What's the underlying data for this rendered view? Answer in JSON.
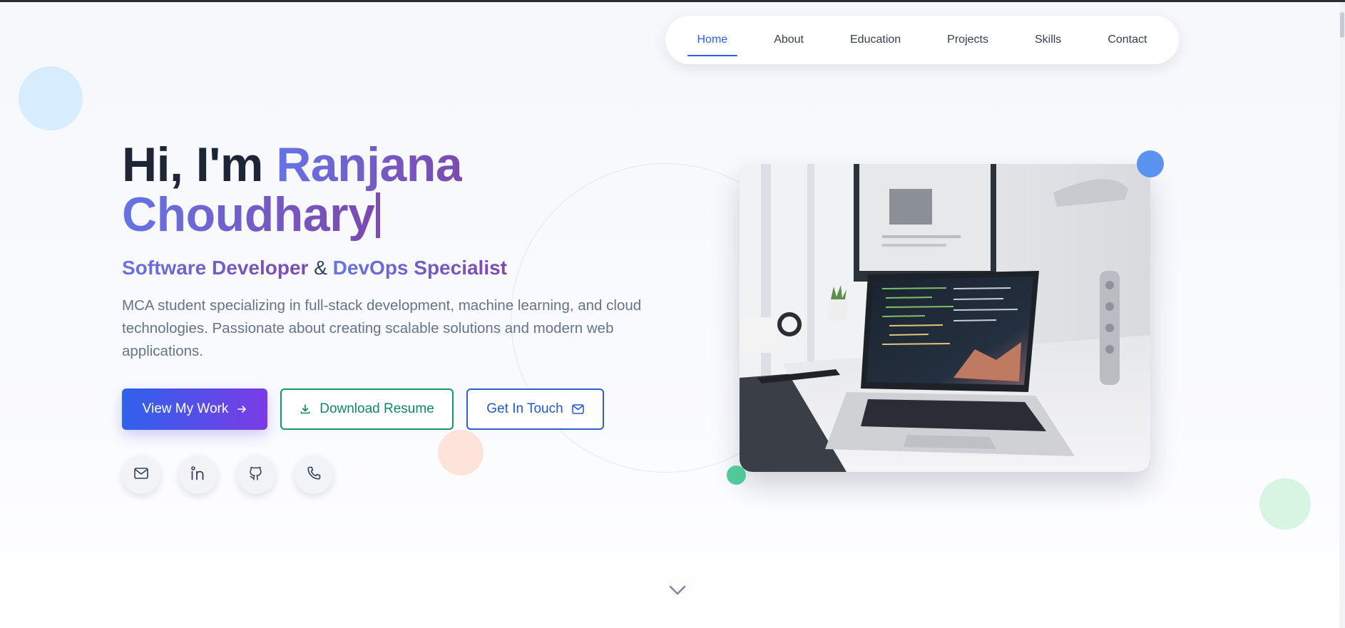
{
  "nav": {
    "items": [
      {
        "label": "Home",
        "active": true
      },
      {
        "label": "About",
        "active": false
      },
      {
        "label": "Education",
        "active": false
      },
      {
        "label": "Projects",
        "active": false
      },
      {
        "label": "Skills",
        "active": false
      },
      {
        "label": "Contact",
        "active": false
      }
    ]
  },
  "hero": {
    "greeting": "Hi, I'm ",
    "first_name": "Ranjana",
    "last_name": "Choudhary",
    "role_primary": "Software Developer",
    "role_sep": "&",
    "role_secondary": "DevOps Specialist",
    "description": "MCA student specializing in full-stack development, machine learning, and cloud technologies. Passionate about creating scalable solutions and modern web applications."
  },
  "buttons": {
    "view_work": "View My Work",
    "download_resume": "Download Resume",
    "get_in_touch": "Get In Touch"
  },
  "social": [
    "mail-icon",
    "linkedin-icon",
    "github-icon",
    "phone-icon"
  ],
  "icons": {
    "arrow": "arrow-right-icon",
    "download": "download-icon",
    "mail": "mail-icon",
    "scroll": "chevron-down-icon"
  },
  "colors": {
    "accent_blue": "#2563eb",
    "accent_purple": "#7b3be6",
    "accent_green": "#10976a",
    "text_dark": "#1e2537",
    "text_muted": "#64748b"
  }
}
